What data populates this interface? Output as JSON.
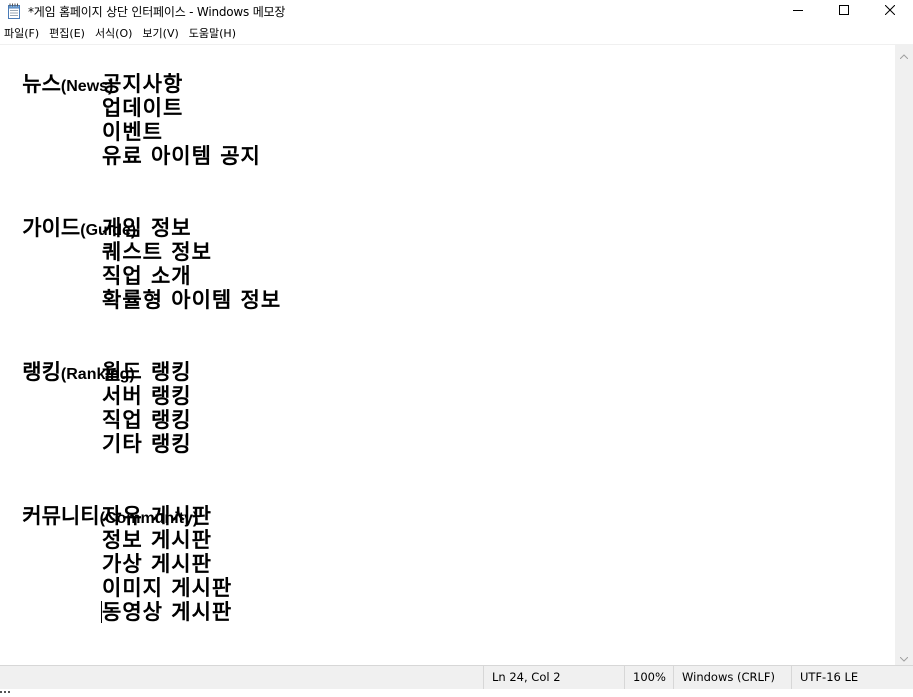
{
  "window": {
    "title": "*게임 홈페이지 상단 인터페이스 - Windows 메모장",
    "app_icon": "notepad-icon",
    "controls": {
      "minimize": "─",
      "maximize": "☐",
      "close": "✕"
    }
  },
  "menu": {
    "items": [
      "파일(F)",
      "편집(E)",
      "서식(O)",
      "보기(V)",
      "도움말(H)"
    ]
  },
  "document": {
    "sections": [
      {
        "heading_ko": "뉴스",
        "heading_en": "(News)",
        "items": [
          "공지사항",
          "업데이트",
          "이벤트",
          "유료 아이템 공지"
        ]
      },
      {
        "heading_ko": "가이드",
        "heading_en": "(Guide)",
        "items": [
          "게임 정보",
          "퀘스트 정보",
          "직업 소개",
          "확률형 아이템 정보"
        ]
      },
      {
        "heading_ko": "랭킹",
        "heading_en": "(Ranking)",
        "items": [
          "월드 랭킹",
          "서버 랭킹",
          "직업 랭킹",
          "기타 랭킹"
        ]
      },
      {
        "heading_ko": "커뮤니티",
        "heading_en": "(Community)",
        "items": [
          "자유 게시판",
          "정보 게시판",
          "가상 게시판",
          "이미지 게시판",
          "동영상 게시판"
        ]
      }
    ]
  },
  "statusbar": {
    "position": "Ln 24, Col 2",
    "zoom": "100%",
    "line_ending": "Windows (CRLF)",
    "encoding": "UTF-16 LE"
  },
  "colors": {
    "text": "#000000",
    "background": "#ffffff",
    "statusbar_bg": "#f0f0f0"
  }
}
